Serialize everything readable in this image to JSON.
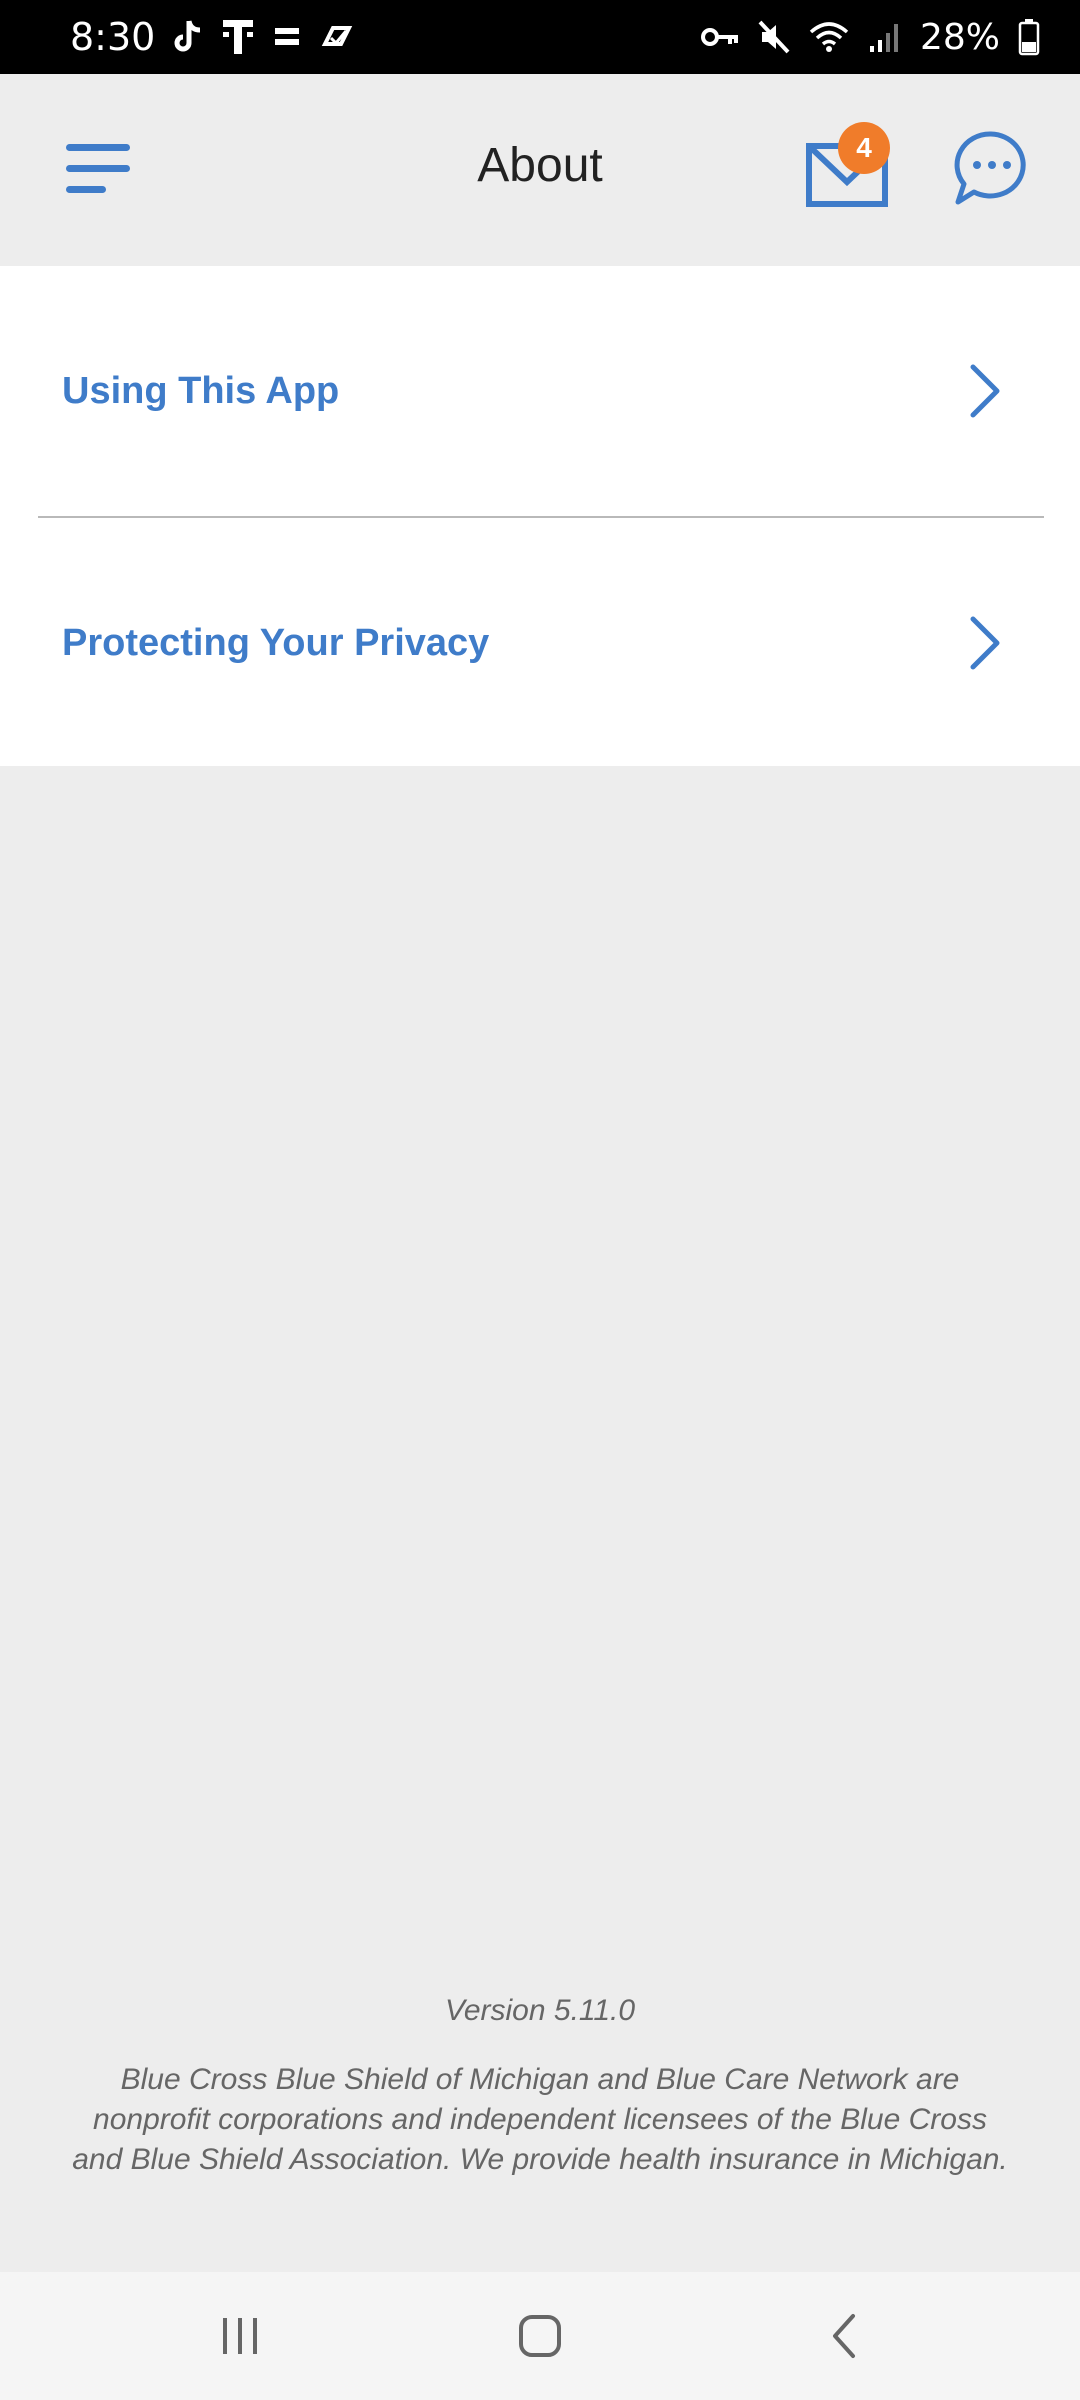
{
  "status_bar": {
    "time": "8:30",
    "battery_percent": "28%",
    "left_icons": [
      "tiktok-icon",
      "t-mobile-icon",
      "hbo-max-icon",
      "app-notification-icon"
    ],
    "right_icons": [
      "vpn-key-icon",
      "mute-icon",
      "wifi-icon",
      "signal-icon",
      "battery-icon"
    ]
  },
  "header": {
    "title": "About",
    "inbox_badge_count": "4",
    "accent_color": "#3f7cc9",
    "badge_color": "#f07c2a"
  },
  "menu": {
    "items": [
      {
        "label": "Using This App"
      },
      {
        "label": "Protecting Your Privacy"
      }
    ]
  },
  "footer": {
    "version": "Version 5.11.0",
    "disclaimer": "Blue Cross Blue Shield of Michigan and Blue Care Network are nonprofit corporations and independent licensees of the Blue Cross and Blue Shield Association. We provide health insurance in Michigan."
  },
  "nav_bar": {
    "buttons": [
      "recent-apps-icon",
      "home-icon",
      "back-icon"
    ]
  }
}
